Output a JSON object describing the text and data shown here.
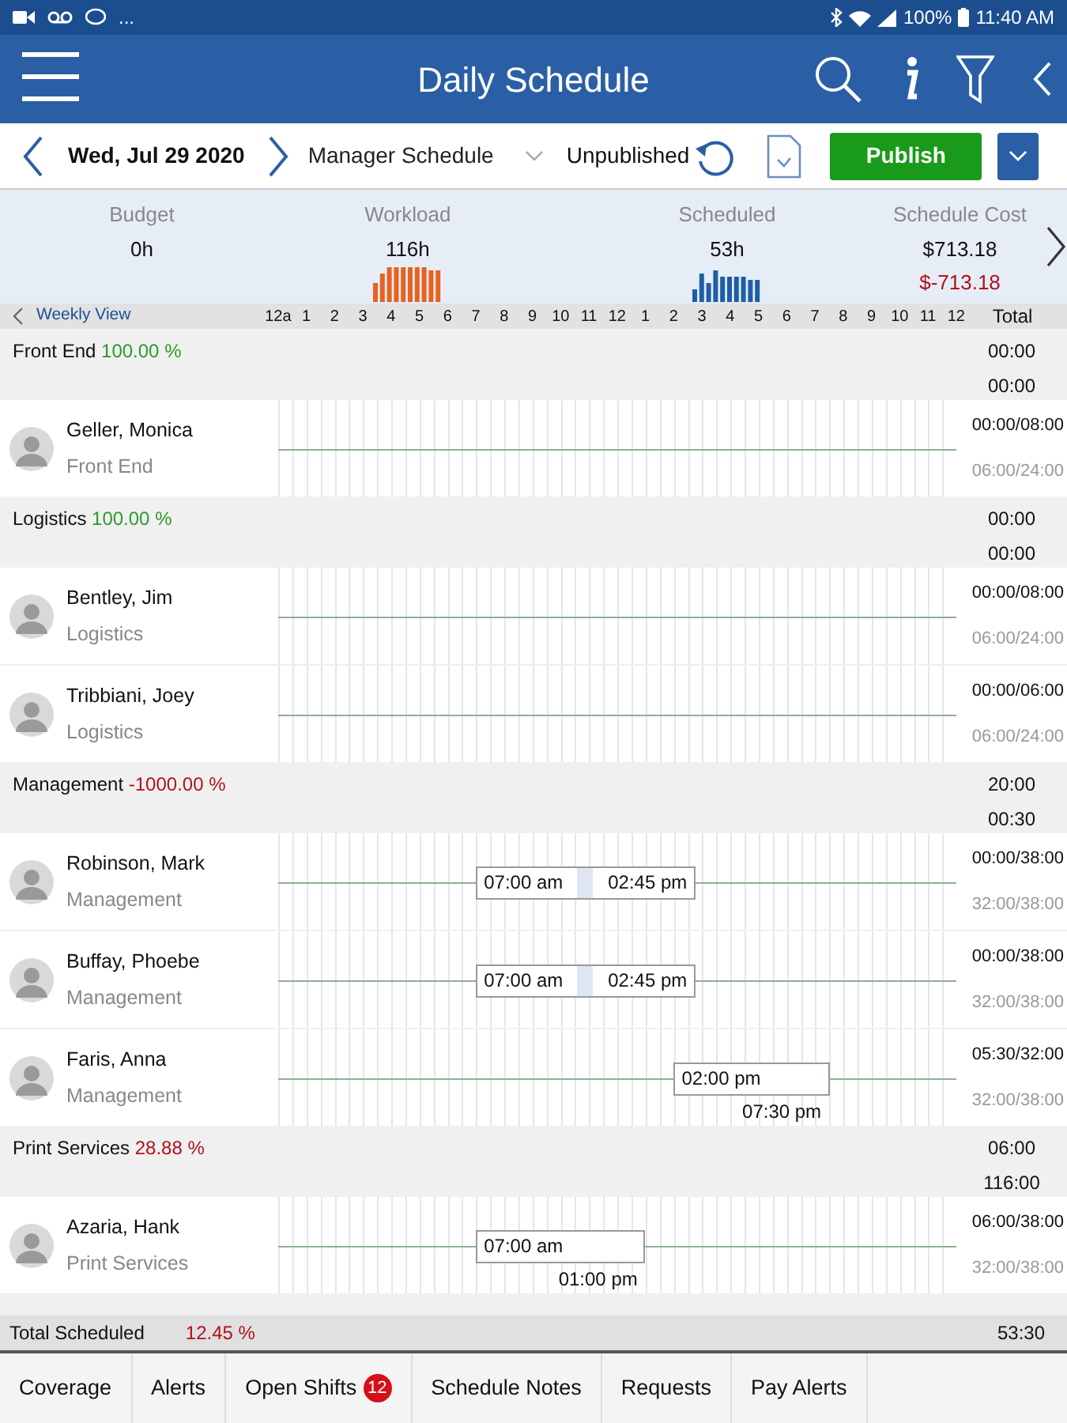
{
  "status_bar": {
    "left_text": "...",
    "battery": "100%",
    "time": "11:40 AM"
  },
  "app_bar": {
    "title": "Daily Schedule"
  },
  "toolbar": {
    "date": "Wed, Jul 29 2020",
    "schedule": "Manager Schedule",
    "status": "Unpublished",
    "publish_button": "Publish"
  },
  "summary": [
    {
      "label": "Budget",
      "value": "0h",
      "kind": "plain"
    },
    {
      "label": "Workload",
      "value": "116h",
      "kind": "workload"
    },
    {
      "label": "Scheduled",
      "value": "53h",
      "kind": "scheduled"
    },
    {
      "label": "Schedule Cost",
      "value": "$713.18",
      "variance": "$-713.18",
      "kind": "cost"
    }
  ],
  "timeline_header": {
    "weekly_view": "Weekly View",
    "hours": [
      "12a",
      "1",
      "2",
      "3",
      "4",
      "5",
      "6",
      "7",
      "8",
      "9",
      "10",
      "11",
      "12",
      "1",
      "2",
      "3",
      "4",
      "5",
      "6",
      "7",
      "8",
      "9",
      "10",
      "11",
      "12"
    ],
    "total": "Total"
  },
  "rows": [
    {
      "kind": "group",
      "name": "Front End",
      "percent": "100.00 %",
      "color": "#2a9a2a",
      "total_1": "00:00",
      "total_2": "00:00"
    },
    {
      "kind": "employee",
      "name": "Geller, Monica",
      "department": "Front End",
      "total_1": "00:00/08:00",
      "total_2": "06:00/24:00"
    },
    {
      "kind": "group",
      "name": "Logistics",
      "percent": "100.00 %",
      "color": "#2a9a2a",
      "total_1": "00:00",
      "total_2": "00:00"
    },
    {
      "kind": "employee",
      "name": "Bentley, Jim",
      "department": "Logistics",
      "total_1": "00:00/08:00",
      "total_2": "06:00/24:00"
    },
    {
      "kind": "employee",
      "name": "Tribbiani, Joey",
      "department": "Logistics",
      "total_1": "00:00/06:00",
      "total_2": "06:00/24:00"
    },
    {
      "kind": "group",
      "name": "Management",
      "percent": "-1000.00 %",
      "color": "#b0101a",
      "total_1": "20:00",
      "total_2": "00:30"
    },
    {
      "kind": "employee",
      "name": "Robinson, Mark",
      "department": "Management",
      "total_1": "00:00/38:00",
      "total_2": "32:00/38:00",
      "shifts": [
        {
          "kind": "inline",
          "start": "07:00 am",
          "end": "02:45 pm"
        }
      ]
    },
    {
      "kind": "employee",
      "name": "Buffay, Phoebe",
      "department": "Management",
      "total_1": "00:00/38:00",
      "total_2": "32:00/38:00",
      "shifts": [
        {
          "kind": "inline",
          "start": "07:00 am",
          "end": "02:45 pm"
        }
      ]
    },
    {
      "kind": "employee",
      "name": "Faris, Anna",
      "department": "Management",
      "total_1": "05:30/32:00",
      "total_2": "32:00/38:00",
      "shifts": [
        {
          "kind": "stacked",
          "start": "02:00 pm",
          "end": "07:30 pm"
        }
      ]
    },
    {
      "kind": "group",
      "name": "Print Services",
      "percent": "28.88 %",
      "color": "#b0101a",
      "total_1": "06:00",
      "total_2": "116:00"
    },
    {
      "kind": "employee",
      "name": "Azaria, Hank",
      "department": "Print Services",
      "total_1": "06:00/38:00",
      "total_2": "32:00/38:00",
      "shifts": [
        {
          "kind": "stacked",
          "start": "07:00 am",
          "end": "01:00 pm"
        }
      ]
    }
  ],
  "totals": {
    "label": "Total Scheduled",
    "percent": "12.45 %",
    "value": "53:30"
  },
  "bottom_tabs": [
    {
      "label": "Coverage"
    },
    {
      "label": "Alerts"
    },
    {
      "label": "Open Shifts",
      "badge": "12"
    },
    {
      "label": "Schedule Notes"
    },
    {
      "label": "Requests"
    },
    {
      "label": "Pay Alerts"
    }
  ]
}
